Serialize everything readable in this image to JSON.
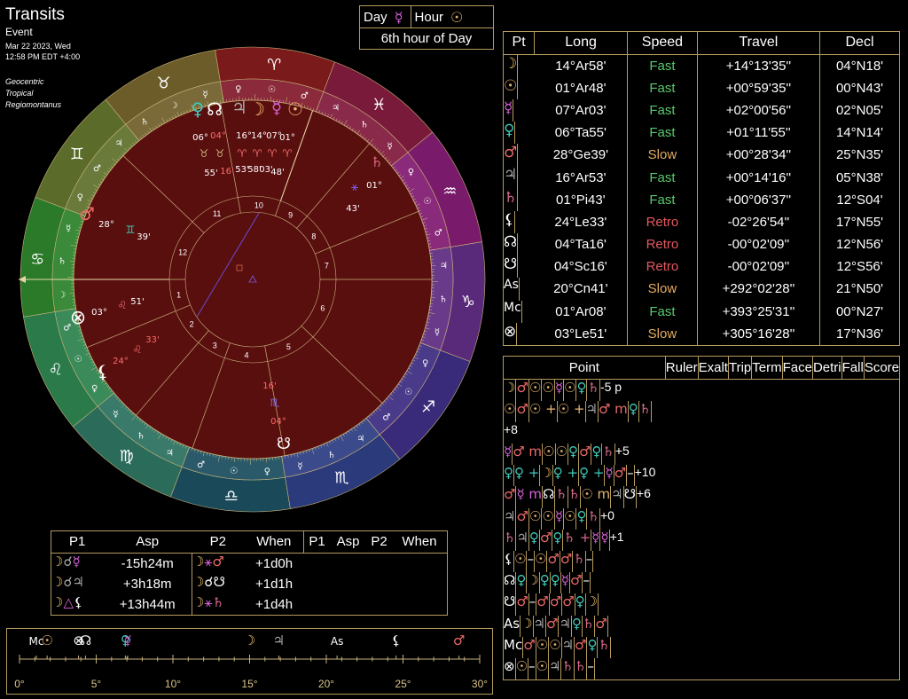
{
  "header": {
    "title": "Transits",
    "subtitle": "Event",
    "date": "Mar 22 2023, Wed",
    "time": "12:58 PM EDT +4:00",
    "system1": "Geocentric",
    "system2": "Tropical",
    "system3": "Regiomontanus"
  },
  "day_hour": {
    "day_label": "Day",
    "day_glyph": "☿",
    "hour_label": "Hour",
    "hour_glyph": "☉",
    "hour_text": "6th hour of Day"
  },
  "positions": {
    "headers": [
      "Pt",
      "Long",
      "Speed",
      "Travel",
      "Decl"
    ],
    "rows": [
      {
        "glyph": "☽",
        "cls": "moon",
        "long": "14°Ar58'",
        "speed": "Fast",
        "scls": "fast",
        "travel": "+14°13'35''",
        "decl": "04°N18'"
      },
      {
        "glyph": "☉",
        "cls": "sun",
        "long": "01°Ar48'",
        "speed": "Fast",
        "scls": "fast",
        "travel": "+00°59'35''",
        "decl": "00°N43'"
      },
      {
        "glyph": "☿",
        "cls": "merc",
        "long": "07°Ar03'",
        "speed": "Fast",
        "scls": "fast",
        "travel": "+02°00'56''",
        "decl": "02°N05'"
      },
      {
        "glyph": "♀",
        "cls": "ven",
        "long": "06°Ta55'",
        "speed": "Fast",
        "scls": "fast",
        "travel": "+01°11'55''",
        "decl": "14°N14'"
      },
      {
        "glyph": "♂",
        "cls": "mars",
        "long": "28°Ge39'",
        "speed": "Slow",
        "scls": "slow",
        "travel": "+00°28'34''",
        "decl": "25°N35'"
      },
      {
        "glyph": "♃",
        "cls": "jup",
        "long": "16°Ar53'",
        "speed": "Fast",
        "scls": "fast",
        "travel": "+00°14'16''",
        "decl": "05°N38'"
      },
      {
        "glyph": "♄",
        "cls": "sat",
        "long": "01°Pi43'",
        "speed": "Fast",
        "scls": "fast",
        "travel": "+00°06'37''",
        "decl": "12°S04'"
      },
      {
        "glyph": "⚸",
        "cls": "wh",
        "long": "24°Le33'",
        "speed": "Retro",
        "scls": "retro",
        "travel": "-02°26'54''",
        "decl": "17°N55'"
      },
      {
        "glyph": "☊",
        "cls": "wh",
        "long": "04°Ta16'",
        "speed": "Retro",
        "scls": "retro",
        "travel": "-00°02'09''",
        "decl": "12°N56'"
      },
      {
        "glyph": "☋",
        "cls": "wh",
        "long": "04°Sc16'",
        "speed": "Retro",
        "scls": "retro",
        "travel": "-00°02'09''",
        "decl": "12°S56'"
      },
      {
        "glyph": "As",
        "cls": "wh",
        "long": "20°Cn41'",
        "speed": "Slow",
        "scls": "slow",
        "travel": "+292°02'28''",
        "decl": "21°N50'"
      },
      {
        "glyph": "Mc",
        "cls": "wh",
        "long": "01°Ar08'",
        "speed": "Fast",
        "scls": "fast",
        "travel": "+393°25'31''",
        "decl": "00°N27'"
      },
      {
        "glyph": "⊗",
        "cls": "wh",
        "long": "03°Le51'",
        "speed": "Slow",
        "scls": "slow",
        "travel": "+305°16'28''",
        "decl": "17°N36'"
      }
    ]
  },
  "dignities": {
    "headers": [
      "Point",
      "Ruler",
      "Exalt",
      "Trip",
      "Term",
      "Face",
      "Detri",
      "Fall",
      "Score"
    ],
    "rows": [
      [
        [
          "☽",
          "moon"
        ],
        [
          "♂",
          "mars"
        ],
        [
          "☉",
          "sun"
        ],
        [
          "☉",
          "sun"
        ],
        [
          "☿",
          "merc"
        ],
        [
          "☉",
          "sun"
        ],
        [
          "♀",
          "ven"
        ],
        [
          "♄",
          "sat"
        ],
        [
          "-5 p",
          "wh"
        ]
      ],
      [
        [
          "☉",
          "sun"
        ],
        [
          "♂",
          "mars"
        ],
        [
          "☉ +",
          "sun"
        ],
        [
          "☉ +",
          "sun"
        ],
        [
          "♃",
          "jup"
        ],
        [
          "♂ m",
          "mars"
        ],
        [
          "♀",
          "ven"
        ],
        [
          "♄",
          "sat"
        ],
        [
          "+8",
          "wh"
        ]
      ],
      [
        [
          "☿",
          "merc"
        ],
        [
          "♂ m",
          "mars"
        ],
        [
          "☉",
          "sun"
        ],
        [
          "☉",
          "sun"
        ],
        [
          "♀",
          "ven"
        ],
        [
          "♂",
          "mars"
        ],
        [
          "♀",
          "ven"
        ],
        [
          "♄",
          "sat"
        ],
        [
          "+5",
          "wh"
        ]
      ],
      [
        [
          "♀",
          "ven"
        ],
        [
          "♀ +",
          "ven"
        ],
        [
          "☽",
          "moon"
        ],
        [
          "♀ +",
          "ven"
        ],
        [
          "♀ +",
          "ven"
        ],
        [
          "☿",
          "merc"
        ],
        [
          "♂",
          "mars"
        ],
        [
          "–",
          "wh"
        ],
        [
          "+10",
          "wh"
        ]
      ],
      [
        [
          "♂",
          "mars"
        ],
        [
          "☿ m",
          "merc"
        ],
        [
          "☊",
          "wh"
        ],
        [
          "♄",
          "sat"
        ],
        [
          "♄",
          "sat"
        ],
        [
          "☉ m",
          "sun"
        ],
        [
          "♃",
          "jup"
        ],
        [
          "☋",
          "wh"
        ],
        [
          "+6",
          "wh"
        ]
      ],
      [
        [
          "♃",
          "jup"
        ],
        [
          "♂",
          "mars"
        ],
        [
          "☉",
          "sun"
        ],
        [
          "☉",
          "sun"
        ],
        [
          "☿",
          "merc"
        ],
        [
          "☉",
          "sun"
        ],
        [
          "♀",
          "ven"
        ],
        [
          "♄",
          "sat"
        ],
        [
          "+0",
          "wh"
        ]
      ],
      [
        [
          "♄",
          "sat"
        ],
        [
          "♃",
          "jup"
        ],
        [
          "♀",
          "ven"
        ],
        [
          "♂",
          "mars"
        ],
        [
          "♀",
          "ven"
        ],
        [
          "♄ +",
          "sat"
        ],
        [
          "☿",
          "merc"
        ],
        [
          "☿",
          "merc"
        ],
        [
          "+1",
          "wh"
        ]
      ],
      [
        [
          "⚸",
          "wh"
        ],
        [
          "☉",
          "sun"
        ],
        [
          "–",
          "wh"
        ],
        [
          "☉",
          "sun"
        ],
        [
          "♂",
          "mars"
        ],
        [
          "♂",
          "mars"
        ],
        [
          "♄",
          "sat"
        ],
        [
          "–",
          "wh"
        ],
        [
          "",
          "wh"
        ]
      ],
      [
        [
          "☊",
          "wh"
        ],
        [
          "♀",
          "ven"
        ],
        [
          "☽",
          "moon"
        ],
        [
          "♀",
          "ven"
        ],
        [
          "♀",
          "ven"
        ],
        [
          "☿",
          "merc"
        ],
        [
          "♂",
          "mars"
        ],
        [
          "–",
          "wh"
        ],
        [
          "",
          "wh"
        ]
      ],
      [
        [
          "☋",
          "wh"
        ],
        [
          "♂",
          "mars"
        ],
        [
          "–",
          "wh"
        ],
        [
          "♂",
          "mars"
        ],
        [
          "♂",
          "mars"
        ],
        [
          "♂",
          "mars"
        ],
        [
          "♀",
          "ven"
        ],
        [
          "☽",
          "moon"
        ],
        [
          "",
          "wh"
        ]
      ],
      [
        [
          "As",
          "wh"
        ],
        [
          "☽",
          "moon"
        ],
        [
          "♃",
          "jup"
        ],
        [
          "♂",
          "mars"
        ],
        [
          "♃",
          "jup"
        ],
        [
          "♀",
          "ven"
        ],
        [
          "♄",
          "sat"
        ],
        [
          "♂",
          "mars"
        ],
        [
          "",
          "wh"
        ]
      ],
      [
        [
          "Mc",
          "wh"
        ],
        [
          "♂",
          "mars"
        ],
        [
          "☉",
          "sun"
        ],
        [
          "☉",
          "sun"
        ],
        [
          "♃",
          "jup"
        ],
        [
          "♂",
          "mars"
        ],
        [
          "♀",
          "ven"
        ],
        [
          "♄",
          "sat"
        ],
        [
          "",
          "wh"
        ]
      ],
      [
        [
          "⊗",
          "wh"
        ],
        [
          "☉",
          "sun"
        ],
        [
          "–",
          "wh"
        ],
        [
          "☉",
          "sun"
        ],
        [
          "♃",
          "jup"
        ],
        [
          "♄",
          "sat"
        ],
        [
          "♄",
          "sat"
        ],
        [
          "–",
          "wh"
        ],
        [
          "",
          "wh"
        ]
      ]
    ]
  },
  "aspects": {
    "headers": [
      "P1",
      "Asp",
      "P2",
      "When",
      "P1",
      "Asp",
      "P2",
      "When"
    ],
    "rows": [
      [
        [
          "☽",
          "moon"
        ],
        [
          "☌",
          "jup"
        ],
        [
          "☿",
          "merc"
        ],
        [
          "-15h24m",
          "wh"
        ],
        [
          "☽",
          "moon"
        ],
        [
          "⚹",
          "merc"
        ],
        [
          "♂",
          "mars"
        ],
        [
          "+1d0h",
          "wh"
        ]
      ],
      [
        [
          "☽",
          "moon"
        ],
        [
          "☌",
          "jup"
        ],
        [
          "♃",
          "jup"
        ],
        [
          "+3h18m",
          "wh"
        ],
        [
          "☽",
          "moon"
        ],
        [
          "☌",
          "wh"
        ],
        [
          "☋",
          "wh"
        ],
        [
          "+1d1h",
          "wh"
        ]
      ],
      [
        [
          "☽",
          "moon"
        ],
        [
          "△",
          "merc"
        ],
        [
          "⚸",
          "wh"
        ],
        [
          "+13h44m",
          "wh"
        ],
        [
          "☽",
          "moon"
        ],
        [
          "⚹",
          "merc"
        ],
        [
          "♄",
          "sat"
        ],
        [
          "+1d4h",
          "wh"
        ]
      ]
    ]
  },
  "ruler": {
    "ticks": [
      "0°",
      "5°",
      "10°",
      "15°",
      "20°",
      "25°",
      "30°"
    ],
    "glyphs": [
      {
        "g": "Mc",
        "deg": 1.1,
        "cls": "wh"
      },
      {
        "g": "☉",
        "deg": 1.8,
        "cls": "sun"
      },
      {
        "g": "⊗",
        "deg": 3.85,
        "cls": "wh"
      },
      {
        "g": "☊",
        "deg": 4.3,
        "cls": "wh"
      },
      {
        "g": "♀",
        "deg": 6.9,
        "cls": "ven"
      },
      {
        "g": "☿",
        "deg": 7.05,
        "cls": "merc"
      },
      {
        "g": "☽",
        "deg": 15.0,
        "cls": "moon"
      },
      {
        "g": "♃",
        "deg": 16.9,
        "cls": "jup"
      },
      {
        "g": "As",
        "deg": 20.7,
        "cls": "wh"
      },
      {
        "g": "⚸",
        "deg": 24.55,
        "cls": "wh"
      },
      {
        "g": "♂",
        "deg": 28.65,
        "cls": "mars"
      }
    ]
  },
  "wheel": {
    "signs": [
      "♈",
      "♉",
      "♊",
      "♋",
      "♌",
      "♍",
      "♎",
      "♏",
      "♐",
      "♑",
      "♒",
      "♓"
    ],
    "sign_colors": [
      "#7a1a1a",
      "#6b5c2a",
      "#5a6b2a",
      "#2a7a2a",
      "#2a7a4a",
      "#2a6b5a",
      "#1a4a5a",
      "#2a3a7a",
      "#3a2a7a",
      "#5a2a7a",
      "#7a1a6a",
      "#7a1a3a"
    ],
    "houses": [
      "1",
      "2",
      "3",
      "4",
      "5",
      "6",
      "7",
      "8",
      "9",
      "10",
      "11",
      "12"
    ],
    "planets": [
      {
        "g": "☽",
        "cls": "moon",
        "deg": "14°",
        "min": "58'",
        "sgn": "♈"
      },
      {
        "g": "☉",
        "cls": "sun",
        "deg": "01°",
        "min": "48'",
        "sgn": "♈"
      },
      {
        "g": "☿",
        "cls": "merc",
        "deg": "07°",
        "min": "03'",
        "sgn": "♈"
      },
      {
        "g": "♀",
        "cls": "ven",
        "deg": "06°",
        "min": "55'",
        "sgn": "♉"
      },
      {
        "g": "♂",
        "cls": "mars",
        "deg": "28°",
        "min": "39'",
        "sgn": "♊"
      },
      {
        "g": "♃",
        "cls": "jup",
        "deg": "16°",
        "min": "53'",
        "sgn": "♈"
      },
      {
        "g": "♄",
        "cls": "sat",
        "deg": "01°",
        "min": "43'",
        "sgn": "♓"
      },
      {
        "g": "⚸",
        "cls": "wh",
        "deg": "24°",
        "min": "33'",
        "sgn": "♌"
      },
      {
        "g": "☊",
        "cls": "wh",
        "deg": "04°",
        "min": "16'",
        "sgn": "♉"
      },
      {
        "g": "☋",
        "cls": "wh",
        "deg": "04°",
        "min": "16'",
        "sgn": "♏"
      },
      {
        "g": "⊗",
        "cls": "wh",
        "deg": "03°",
        "min": "51'",
        "sgn": "♌"
      }
    ],
    "labels": {
      "l04": "04°",
      "l16": "16°",
      "l14": "14°",
      "l07": "07°",
      "l01": "01°",
      "l06": "06°",
      "l55": "55'",
      "l16b": "16'",
      "l53": "53'",
      "l58": "58'",
      "l03": "03'",
      "l48": "48'",
      "sat_deg": "01°",
      "sat_min": "43'",
      "mars_deg": "28°",
      "mars_min": "39'",
      "pof_deg": "03°",
      "pof_min": "51'",
      "lil_deg": "24°",
      "lil_min": "33'",
      "sn_deg": "04°",
      "sn_min": "16'"
    }
  }
}
